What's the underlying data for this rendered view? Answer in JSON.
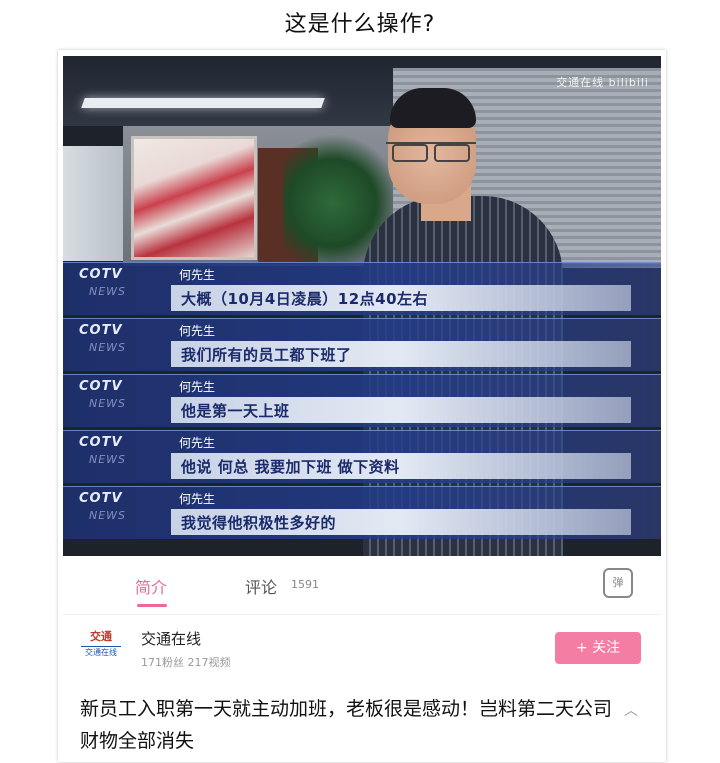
{
  "question": "这是什么操作?",
  "video": {
    "watermark": "交通在线 bilibili",
    "captions": [
      {
        "logo": "COTV",
        "logo_sub": "NEWS",
        "speaker": "何先生",
        "text": "大概（10月4日凌晨）12点40左右"
      },
      {
        "logo": "COTV",
        "logo_sub": "NEWS",
        "speaker": "何先生",
        "text": "我们所有的员工都下班了"
      },
      {
        "logo": "COTV",
        "logo_sub": "NEWS",
        "speaker": "何先生",
        "text": "他是第一天上班"
      },
      {
        "logo": "COTV",
        "logo_sub": "NEWS",
        "speaker": "何先生",
        "text": "他说 何总 我要加下班 做下资料"
      },
      {
        "logo": "COTV",
        "logo_sub": "NEWS",
        "speaker": "何先生",
        "text": "我觉得他积极性多好的"
      }
    ]
  },
  "tabs": {
    "intro": "简介",
    "comments": "评论",
    "comment_count": "1591",
    "danmaku_icon": "弹"
  },
  "uploader": {
    "avatar_top": "交通",
    "avatar_bottom": "交通在线",
    "name": "交通在线",
    "stats": "171粉丝  217视频",
    "follow": "+ 关注"
  },
  "title": "新员工入职第一天就主动加班，老板很是感动！岂料第二天公司财物全部消失",
  "expand_icon": "︿",
  "colors": {
    "accent": "#f0679a",
    "follow_bg": "#f47ea3",
    "caption_blue": "#1e306e"
  }
}
